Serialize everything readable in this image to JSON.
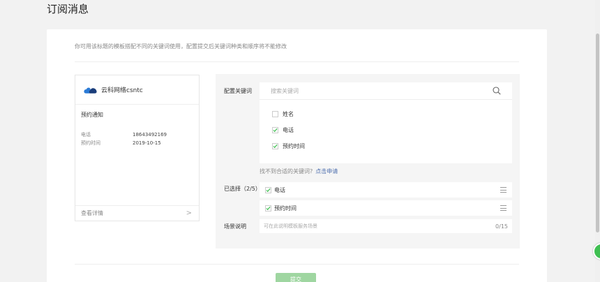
{
  "page": {
    "title": "订阅消息"
  },
  "description": "你可用该标题的模板搭配不同的关键词使用，配置提交后关键词种类和顺序将不能修改",
  "preview": {
    "brand_name": "云科网络csntc",
    "notice_title": "预约通知",
    "fields": [
      {
        "key": "电话",
        "value": "18643492169"
      },
      {
        "key": "预约时间",
        "value": "2019-10-15"
      }
    ],
    "footer_label": "查看详情",
    "footer_arrow": ">"
  },
  "config": {
    "keywords_label": "配置关键词",
    "search_placeholder": "搜索关键词",
    "options": [
      {
        "label": "姓名",
        "checked": false
      },
      {
        "label": "电话",
        "checked": true
      },
      {
        "label": "预约时间",
        "checked": true
      }
    ],
    "hint_text": "找不到合适的关键词?",
    "hint_link": "点击申请",
    "selected_label": "已选择（2/5）",
    "selected": [
      {
        "label": "电话"
      },
      {
        "label": "预约时间"
      }
    ],
    "scene_label": "场景说明",
    "scene_placeholder": "可在此说明模板服务场景",
    "scene_counter": "0/15"
  },
  "submit_label": "提交",
  "colors": {
    "accent": "#3fbf52",
    "submit_disabled": "#9fd6a1",
    "link": "#4e6fae"
  }
}
